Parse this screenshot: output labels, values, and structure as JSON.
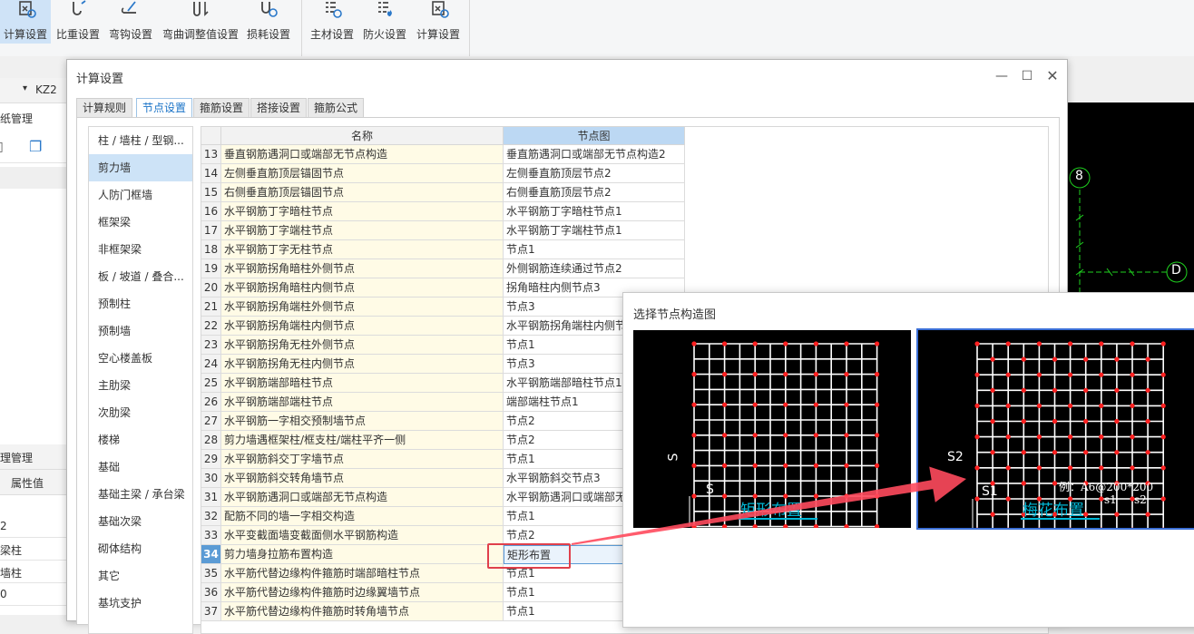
{
  "ribbon": {
    "buttons": [
      {
        "label": "计算设置",
        "icon": "calc-settings-icon",
        "active": true
      },
      {
        "label": "比重设置",
        "icon": "weight-settings-icon"
      },
      {
        "label": "弯钩设置",
        "icon": "hook-settings-icon"
      },
      {
        "label": "弯曲调整值设置",
        "icon": "bend-adjust-icon"
      },
      {
        "label": "损耗设置",
        "icon": "loss-settings-icon"
      },
      {
        "label": "主材设置",
        "icon": "material-settings-icon"
      },
      {
        "label": "防火设置",
        "icon": "fire-settings-icon"
      },
      {
        "label": "计算设置",
        "icon": "calc-settings-icon"
      }
    ]
  },
  "behind": {
    "selector_value": "KZ2",
    "panel1_title": "纸管理",
    "panel2_title": "理管理",
    "prop_header": "属性值",
    "rows": [
      "2",
      "梁柱",
      "墙柱",
      "0"
    ]
  },
  "cad": {
    "axis_labels": [
      "8",
      "D"
    ]
  },
  "dialog": {
    "title": "计算设置",
    "tabs": [
      "计算规则",
      "节点设置",
      "箍筋设置",
      "搭接设置",
      "箍筋公式"
    ],
    "active_tab": 1,
    "left_items": [
      "柱 / 墙柱 / 型钢...",
      "剪力墙",
      "人防门框墙",
      "框架梁",
      "非框架梁",
      "板 / 坡道 / 叠合...",
      "预制柱",
      "预制墙",
      "空心楼盖板",
      "主肋梁",
      "次肋梁",
      "楼梯",
      "基础",
      "基础主梁 / 承台梁",
      "基础次梁",
      "砌体结构",
      "其它",
      "基坑支护"
    ],
    "selected_left": 1,
    "columns": [
      "名称",
      "节点图"
    ],
    "selected_row": "34",
    "rows": [
      {
        "num": "13",
        "name": "垂直钢筋遇洞口或端部无节点构造",
        "node": "垂直筋遇洞口或端部无节点构造2"
      },
      {
        "num": "14",
        "name": "左侧垂直筋顶层锚固节点",
        "node": "左侧垂直筋顶层节点2"
      },
      {
        "num": "15",
        "name": "右侧垂直筋顶层锚固节点",
        "node": "右侧垂直筋顶层节点2"
      },
      {
        "num": "16",
        "name": "水平钢筋丁字暗柱节点",
        "node": "水平钢筋丁字暗柱节点1"
      },
      {
        "num": "17",
        "name": "水平钢筋丁字端柱节点",
        "node": "水平钢筋丁字端柱节点1"
      },
      {
        "num": "18",
        "name": "水平钢筋丁字无柱节点",
        "node": "节点1"
      },
      {
        "num": "19",
        "name": "水平钢筋拐角暗柱外侧节点",
        "node": "外侧钢筋连续通过节点2"
      },
      {
        "num": "20",
        "name": "水平钢筋拐角暗柱内侧节点",
        "node": "拐角暗柱内侧节点3"
      },
      {
        "num": "21",
        "name": "水平钢筋拐角端柱外侧节点",
        "node": "节点3"
      },
      {
        "num": "22",
        "name": "水平钢筋拐角端柱内侧节点",
        "node": "水平钢筋拐角端柱内侧节"
      },
      {
        "num": "23",
        "name": "水平钢筋拐角无柱外侧节点",
        "node": "节点1"
      },
      {
        "num": "24",
        "name": "水平钢筋拐角无柱内侧节点",
        "node": "节点3"
      },
      {
        "num": "25",
        "name": "水平钢筋端部暗柱节点",
        "node": "水平钢筋端部暗柱节点1"
      },
      {
        "num": "26",
        "name": "水平钢筋端部端柱节点",
        "node": "端部端柱节点1"
      },
      {
        "num": "27",
        "name": "水平钢筋一字相交预制墙节点",
        "node": "节点2"
      },
      {
        "num": "28",
        "name": "剪力墙遇框架柱/框支柱/端柱平齐一侧",
        "node": "节点2"
      },
      {
        "num": "29",
        "name": "水平钢筋斜交丁字墙节点",
        "node": "节点1"
      },
      {
        "num": "30",
        "name": "水平钢筋斜交转角墙节点",
        "node": "水平钢筋斜交节点3"
      },
      {
        "num": "31",
        "name": "水平钢筋遇洞口或端部无节点构造",
        "node": "水平钢筋遇洞口或端部无"
      },
      {
        "num": "32",
        "name": "配筋不同的墙一字相交构造",
        "node": "节点1"
      },
      {
        "num": "33",
        "name": "水平变截面墙变截面侧水平钢筋构造",
        "node": "节点2"
      },
      {
        "num": "34",
        "name": "剪力墙身拉筋布置构造",
        "node": "矩形布置"
      },
      {
        "num": "35",
        "name": "水平筋代替边缘构件箍筋时端部暗柱节点",
        "node": "节点1"
      },
      {
        "num": "36",
        "name": "水平筋代替边缘构件箍筋时边缘翼墙节点",
        "node": "节点1"
      },
      {
        "num": "37",
        "name": "水平筋代替边缘构件箍筋时转角墙节点",
        "node": "节点1"
      }
    ]
  },
  "picker": {
    "title": "选择节点构造图",
    "option_a": {
      "caption": "矩形布置",
      "label_s_v": "S",
      "label_s_h": "S"
    },
    "option_b": {
      "caption": "梅花布置",
      "label_s2": "S2",
      "label_s1": "S1",
      "example": "例：A6@200*200",
      "lbl_s1": "s1",
      "lbl_s2": "s2"
    },
    "grid_color": "#ffffff",
    "dot_color": "#ff2020",
    "caption_color": "#00b7d6",
    "arrow_color": "#ff4a5d"
  }
}
